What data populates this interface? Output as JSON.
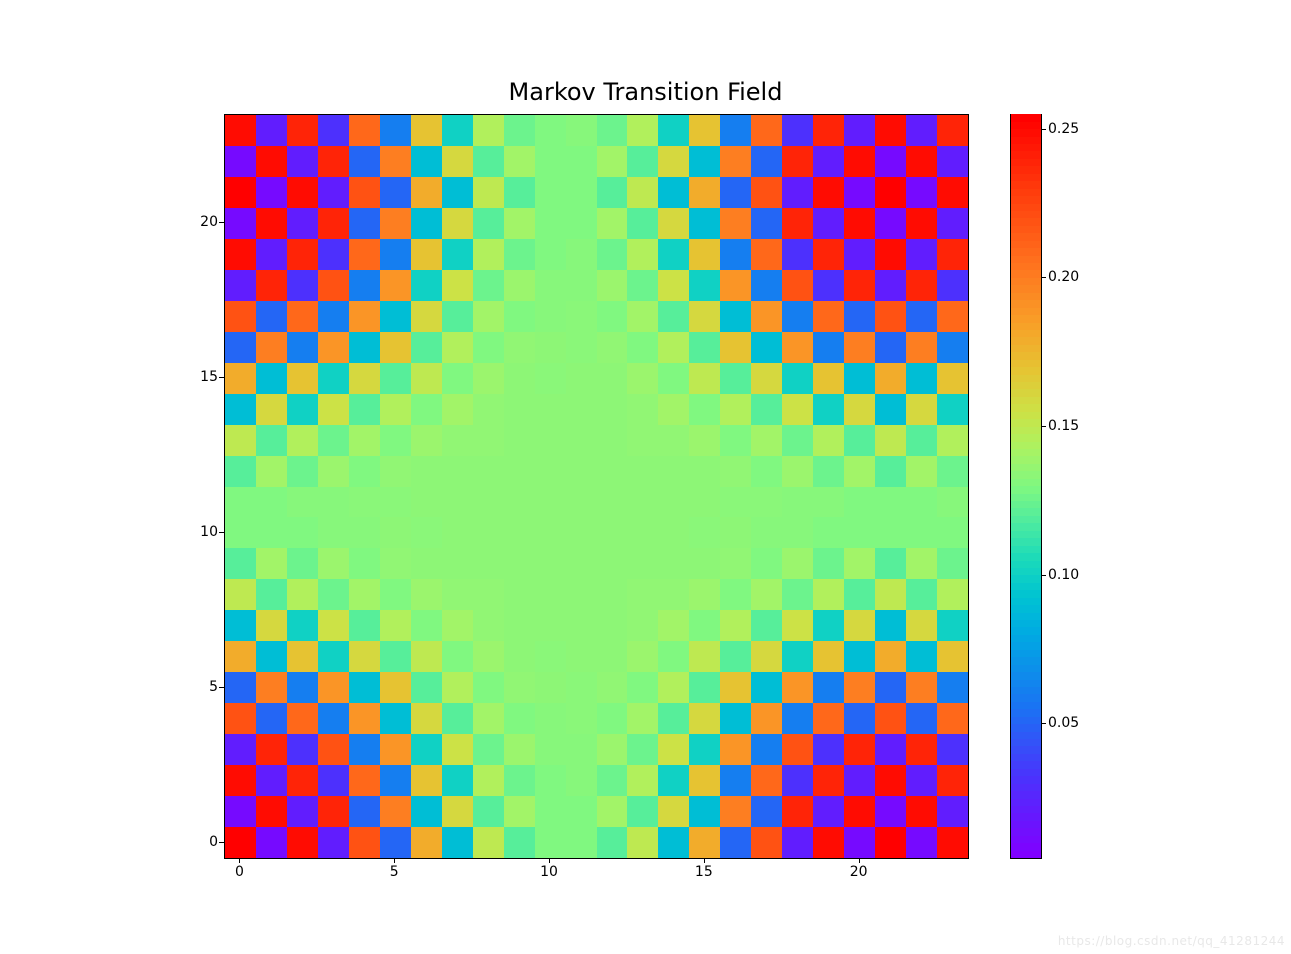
{
  "chart_data": {
    "type": "heatmap",
    "title": "Markov Transition Field",
    "xlabel": "",
    "ylabel": "",
    "xticks": [
      0,
      5,
      10,
      15,
      20
    ],
    "yticks": [
      0,
      5,
      10,
      15,
      20
    ],
    "xlim": [
      -0.5,
      23.5
    ],
    "ylim": [
      -0.5,
      23.5
    ],
    "colorbar_ticks": [
      0.05,
      0.1,
      0.15,
      0.2,
      0.25
    ],
    "vmin": 0.005,
    "vmax": 0.255,
    "size": 24,
    "grid": [
      [
        0.255,
        0.01,
        0.25,
        0.02,
        0.22,
        0.05,
        0.18,
        0.09,
        0.15,
        0.12,
        0.13,
        0.13,
        0.12,
        0.15,
        0.09,
        0.18,
        0.05,
        0.22,
        0.02,
        0.25,
        0.01,
        0.255,
        0.01,
        0.25
      ],
      [
        0.01,
        0.25,
        0.02,
        0.24,
        0.05,
        0.2,
        0.09,
        0.16,
        0.12,
        0.14,
        0.13,
        0.13,
        0.14,
        0.12,
        0.16,
        0.09,
        0.2,
        0.05,
        0.24,
        0.02,
        0.25,
        0.01,
        0.25,
        0.02
      ],
      [
        0.25,
        0.02,
        0.24,
        0.03,
        0.21,
        0.06,
        0.17,
        0.1,
        0.145,
        0.125,
        0.13,
        0.132,
        0.125,
        0.145,
        0.1,
        0.17,
        0.06,
        0.21,
        0.03,
        0.24,
        0.02,
        0.25,
        0.02,
        0.24
      ],
      [
        0.02,
        0.24,
        0.03,
        0.22,
        0.06,
        0.19,
        0.1,
        0.155,
        0.125,
        0.138,
        0.132,
        0.132,
        0.138,
        0.125,
        0.155,
        0.1,
        0.19,
        0.06,
        0.22,
        0.03,
        0.24,
        0.02,
        0.24,
        0.03
      ],
      [
        0.22,
        0.05,
        0.21,
        0.06,
        0.19,
        0.09,
        0.16,
        0.12,
        0.14,
        0.13,
        0.132,
        0.133,
        0.13,
        0.14,
        0.12,
        0.16,
        0.09,
        0.19,
        0.06,
        0.21,
        0.05,
        0.22,
        0.05,
        0.21
      ],
      [
        0.05,
        0.2,
        0.06,
        0.19,
        0.09,
        0.17,
        0.12,
        0.145,
        0.13,
        0.135,
        0.134,
        0.133,
        0.135,
        0.13,
        0.145,
        0.12,
        0.17,
        0.09,
        0.19,
        0.06,
        0.2,
        0.05,
        0.2,
        0.06
      ],
      [
        0.18,
        0.09,
        0.17,
        0.1,
        0.16,
        0.12,
        0.15,
        0.13,
        0.138,
        0.134,
        0.133,
        0.134,
        0.134,
        0.138,
        0.13,
        0.15,
        0.12,
        0.16,
        0.1,
        0.17,
        0.09,
        0.18,
        0.09,
        0.17
      ],
      [
        0.09,
        0.16,
        0.1,
        0.155,
        0.12,
        0.145,
        0.13,
        0.14,
        0.135,
        0.134,
        0.134,
        0.134,
        0.134,
        0.135,
        0.14,
        0.13,
        0.145,
        0.12,
        0.155,
        0.1,
        0.16,
        0.09,
        0.16,
        0.1
      ],
      [
        0.15,
        0.12,
        0.145,
        0.125,
        0.14,
        0.13,
        0.138,
        0.135,
        0.135,
        0.134,
        0.134,
        0.134,
        0.134,
        0.135,
        0.135,
        0.138,
        0.13,
        0.14,
        0.125,
        0.145,
        0.12,
        0.15,
        0.12,
        0.145
      ],
      [
        0.12,
        0.14,
        0.125,
        0.138,
        0.13,
        0.135,
        0.134,
        0.134,
        0.134,
        0.134,
        0.134,
        0.134,
        0.134,
        0.134,
        0.134,
        0.134,
        0.135,
        0.13,
        0.138,
        0.125,
        0.14,
        0.12,
        0.14,
        0.125
      ],
      [
        0.13,
        0.13,
        0.13,
        0.132,
        0.132,
        0.134,
        0.133,
        0.134,
        0.134,
        0.134,
        0.134,
        0.134,
        0.134,
        0.134,
        0.134,
        0.133,
        0.134,
        0.132,
        0.132,
        0.13,
        0.13,
        0.13,
        0.13,
        0.13
      ],
      [
        0.13,
        0.13,
        0.132,
        0.132,
        0.133,
        0.133,
        0.134,
        0.134,
        0.134,
        0.134,
        0.134,
        0.134,
        0.134,
        0.134,
        0.134,
        0.134,
        0.133,
        0.133,
        0.132,
        0.132,
        0.13,
        0.13,
        0.13,
        0.132
      ],
      [
        0.12,
        0.14,
        0.125,
        0.138,
        0.13,
        0.135,
        0.134,
        0.134,
        0.134,
        0.134,
        0.134,
        0.134,
        0.134,
        0.134,
        0.134,
        0.134,
        0.135,
        0.13,
        0.138,
        0.125,
        0.14,
        0.12,
        0.14,
        0.125
      ],
      [
        0.15,
        0.12,
        0.145,
        0.125,
        0.14,
        0.13,
        0.138,
        0.135,
        0.135,
        0.134,
        0.134,
        0.134,
        0.134,
        0.135,
        0.135,
        0.138,
        0.13,
        0.14,
        0.125,
        0.145,
        0.12,
        0.15,
        0.12,
        0.145
      ],
      [
        0.09,
        0.16,
        0.1,
        0.155,
        0.12,
        0.145,
        0.13,
        0.14,
        0.135,
        0.134,
        0.134,
        0.134,
        0.134,
        0.135,
        0.14,
        0.13,
        0.145,
        0.12,
        0.155,
        0.1,
        0.16,
        0.09,
        0.16,
        0.1
      ],
      [
        0.18,
        0.09,
        0.17,
        0.1,
        0.16,
        0.12,
        0.15,
        0.13,
        0.138,
        0.134,
        0.133,
        0.134,
        0.134,
        0.138,
        0.13,
        0.15,
        0.12,
        0.16,
        0.1,
        0.17,
        0.09,
        0.18,
        0.09,
        0.17
      ],
      [
        0.05,
        0.2,
        0.06,
        0.19,
        0.09,
        0.17,
        0.12,
        0.145,
        0.13,
        0.135,
        0.134,
        0.133,
        0.135,
        0.13,
        0.145,
        0.12,
        0.17,
        0.09,
        0.19,
        0.06,
        0.2,
        0.05,
        0.2,
        0.06
      ],
      [
        0.22,
        0.05,
        0.21,
        0.06,
        0.19,
        0.09,
        0.16,
        0.12,
        0.14,
        0.13,
        0.132,
        0.133,
        0.13,
        0.14,
        0.12,
        0.16,
        0.09,
        0.19,
        0.06,
        0.21,
        0.05,
        0.22,
        0.05,
        0.21
      ],
      [
        0.02,
        0.24,
        0.03,
        0.22,
        0.06,
        0.19,
        0.1,
        0.155,
        0.125,
        0.138,
        0.132,
        0.132,
        0.138,
        0.125,
        0.155,
        0.1,
        0.19,
        0.06,
        0.22,
        0.03,
        0.24,
        0.02,
        0.24,
        0.03
      ],
      [
        0.25,
        0.02,
        0.24,
        0.03,
        0.21,
        0.06,
        0.17,
        0.1,
        0.145,
        0.125,
        0.13,
        0.132,
        0.125,
        0.145,
        0.1,
        0.17,
        0.06,
        0.21,
        0.03,
        0.24,
        0.02,
        0.25,
        0.02,
        0.24
      ],
      [
        0.01,
        0.25,
        0.02,
        0.24,
        0.05,
        0.2,
        0.09,
        0.16,
        0.12,
        0.14,
        0.13,
        0.13,
        0.14,
        0.12,
        0.16,
        0.09,
        0.2,
        0.05,
        0.24,
        0.02,
        0.25,
        0.01,
        0.25,
        0.02
      ],
      [
        0.255,
        0.01,
        0.25,
        0.02,
        0.22,
        0.05,
        0.18,
        0.09,
        0.15,
        0.12,
        0.13,
        0.13,
        0.12,
        0.15,
        0.09,
        0.18,
        0.05,
        0.22,
        0.02,
        0.25,
        0.01,
        0.255,
        0.01,
        0.25
      ],
      [
        0.01,
        0.25,
        0.02,
        0.24,
        0.05,
        0.2,
        0.09,
        0.16,
        0.12,
        0.14,
        0.13,
        0.13,
        0.14,
        0.12,
        0.16,
        0.09,
        0.2,
        0.05,
        0.24,
        0.02,
        0.25,
        0.01,
        0.25,
        0.02
      ],
      [
        0.25,
        0.02,
        0.24,
        0.03,
        0.21,
        0.06,
        0.17,
        0.1,
        0.145,
        0.125,
        0.13,
        0.132,
        0.125,
        0.145,
        0.1,
        0.17,
        0.06,
        0.21,
        0.03,
        0.24,
        0.02,
        0.25,
        0.02,
        0.24
      ]
    ]
  },
  "watermark": "https://blog.csdn.net/qq_41281244"
}
